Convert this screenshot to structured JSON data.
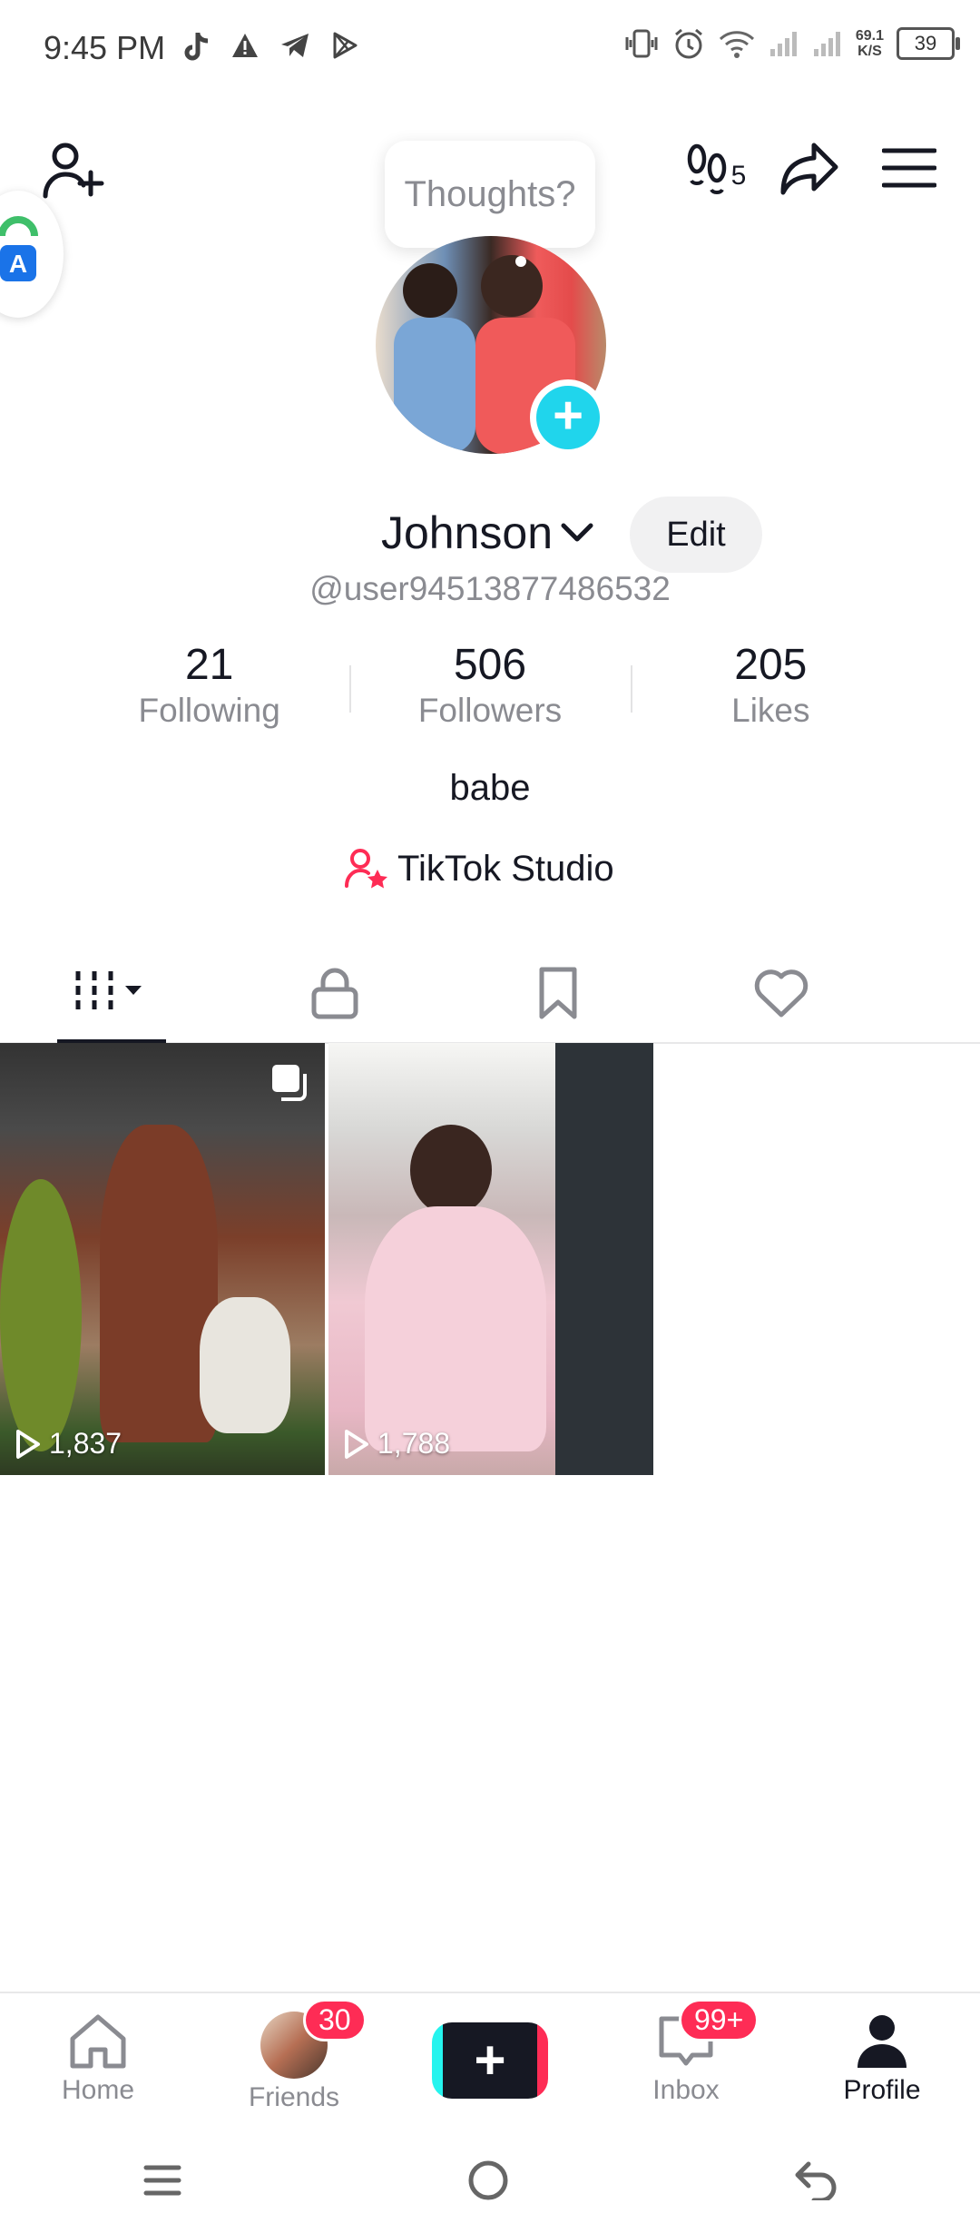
{
  "status_bar": {
    "time": "9:45 PM",
    "net_speed_value": "69.1",
    "net_speed_unit": "K/S",
    "battery": "39"
  },
  "header": {
    "thoughts_placeholder": "Thoughts?",
    "profile_views_count": "5"
  },
  "profile": {
    "name": "Johnson",
    "edit_label": "Edit",
    "handle": "@user94513877486532",
    "stats": [
      {
        "value": "21",
        "label": "Following"
      },
      {
        "value": "506",
        "label": "Followers"
      },
      {
        "value": "205",
        "label": "Likes"
      }
    ],
    "bio": "babe",
    "studio_label": "TikTok Studio"
  },
  "videos": [
    {
      "views": "1,837"
    },
    {
      "views": "1,788"
    }
  ],
  "bottom_nav": {
    "items": [
      {
        "label": "Home"
      },
      {
        "label": "Friends",
        "badge": "30"
      },
      {
        "label": ""
      },
      {
        "label": "Inbox",
        "badge": "99+"
      },
      {
        "label": "Profile"
      }
    ]
  },
  "colors": {
    "accent": "#fe2c55",
    "cyan": "#25f4ee",
    "text_secondary": "#8a8b91"
  }
}
